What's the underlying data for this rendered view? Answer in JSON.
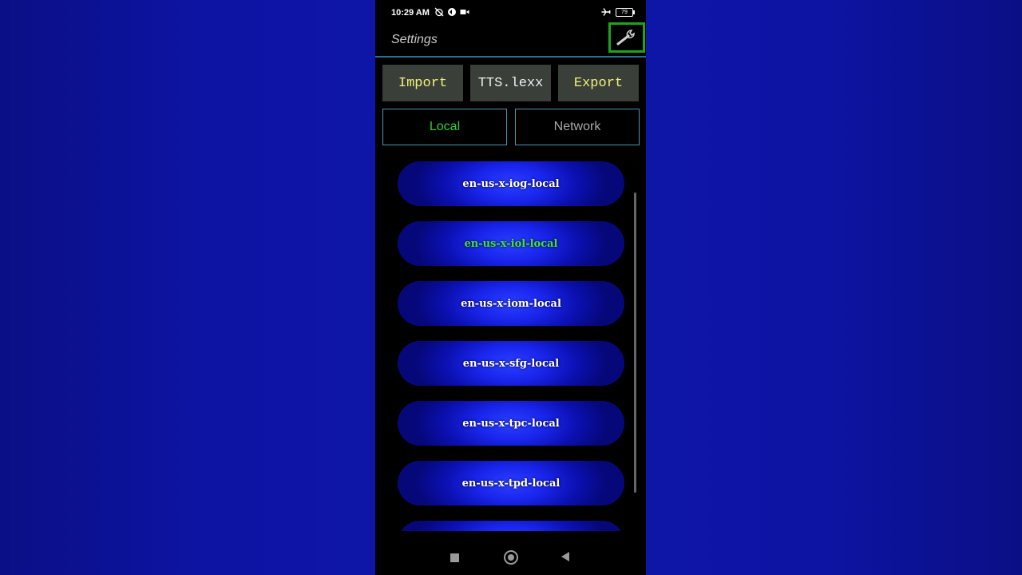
{
  "status_bar": {
    "time": "10:29 AM",
    "battery": "79",
    "left_icons": [
      "alarm-off-icon",
      "sync-icon",
      "video-camera-icon"
    ],
    "right_icons": [
      "airplane-icon",
      "battery-icon"
    ]
  },
  "appbar": {
    "title": "Settings",
    "settings_icon": "wrench-icon"
  },
  "buttons": {
    "import": "Import",
    "tts_lexx": "TTS.lexx",
    "export": "Export"
  },
  "tabs": {
    "local": "Local",
    "network": "Network",
    "active": "Local"
  },
  "voices": [
    {
      "label": "en-us-x-iog-local",
      "selected": false
    },
    {
      "label": "en-us-x-iol-local",
      "selected": true
    },
    {
      "label": "en-us-x-iom-local",
      "selected": false
    },
    {
      "label": "en-us-x-sfg-local",
      "selected": false
    },
    {
      "label": "en-us-x-tpc-local",
      "selected": false
    },
    {
      "label": "en-us-x-tpd-local",
      "selected": false
    },
    {
      "label": "",
      "selected": false
    }
  ],
  "nav_bar": [
    "recents-icon",
    "home-icon",
    "back-icon"
  ],
  "colors": {
    "accent_green": "#31d131",
    "button_yellow": "#f1f17a",
    "voice_blue": "#1a26ee",
    "background_blue": "#0f17ad"
  }
}
